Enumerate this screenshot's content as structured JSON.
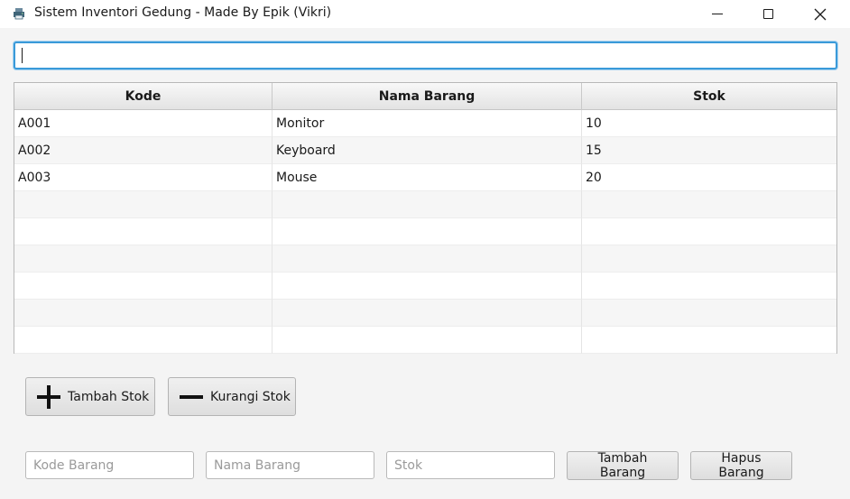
{
  "window": {
    "title": "Sistem Inventori Gedung - Made By Epik (Vikri)",
    "app_icon": "printer-icon",
    "controls": [
      "minimize-icon",
      "maximize-icon",
      "close-icon"
    ]
  },
  "search": {
    "value": "",
    "placeholder": ""
  },
  "table": {
    "columns": [
      "Kode",
      "Nama Barang",
      "Stok"
    ],
    "rows": [
      [
        "A001",
        "Monitor",
        "10"
      ],
      [
        "A002",
        "Keyboard",
        "15"
      ],
      [
        "A003",
        "Mouse",
        "20"
      ],
      [
        "",
        "",
        ""
      ],
      [
        "",
        "",
        ""
      ],
      [
        "",
        "",
        ""
      ],
      [
        "",
        "",
        ""
      ],
      [
        "",
        "",
        ""
      ],
      [
        "",
        "",
        ""
      ]
    ]
  },
  "stock_buttons": {
    "add_label": "Tambah Stok",
    "add_icon": "plus-icon",
    "subtract_label": "Kurangi Stok",
    "subtract_icon": "minus-icon"
  },
  "form": {
    "kode_placeholder": "Kode Barang",
    "nama_placeholder": "Nama Barang",
    "stok_placeholder": "Stok",
    "add_item_label": "Tambah Barang",
    "delete_item_label": "Hapus Barang"
  }
}
